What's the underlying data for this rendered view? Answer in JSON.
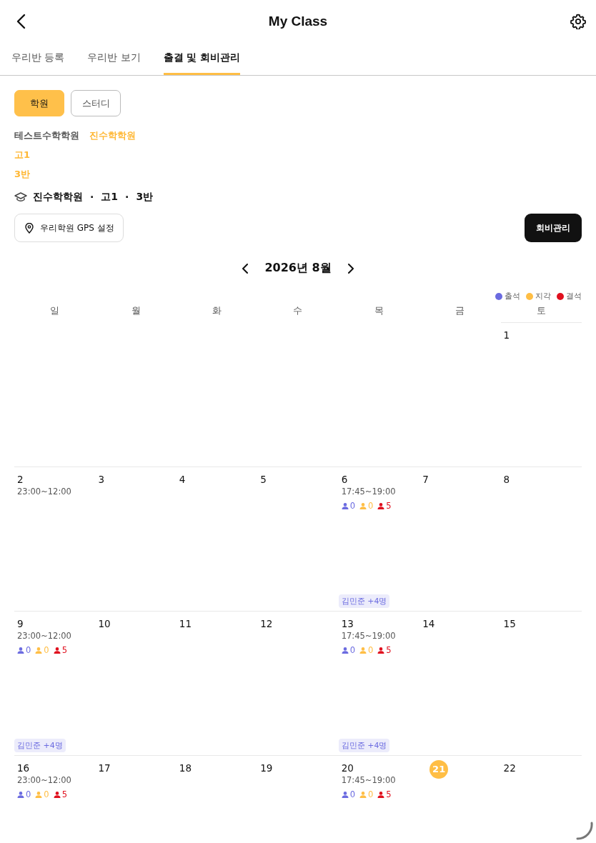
{
  "header": {
    "title": "My Class"
  },
  "tabs": [
    {
      "label": "우리반 등록",
      "selected": false
    },
    {
      "label": "우리반 보기",
      "selected": false
    },
    {
      "label": "출결 및 회비관리",
      "selected": true
    }
  ],
  "segments": [
    {
      "label": "학원",
      "selected": true
    },
    {
      "label": "스터디",
      "selected": false
    }
  ],
  "academies": [
    {
      "label": "테스트수학학원",
      "selected": false
    },
    {
      "label": "진수학학원",
      "selected": true
    }
  ],
  "grades": [
    {
      "label": "고1",
      "selected": true
    }
  ],
  "classes": [
    {
      "label": "3반",
      "selected": true
    }
  ],
  "summary": {
    "academy": "진수학학원",
    "separator_1": "·",
    "grade": "고1",
    "separator_2": "·",
    "class": "3반"
  },
  "gps_button": {
    "label": "우리학원 GPS 설정"
  },
  "fee_button": {
    "label": "회비관리"
  },
  "calendar": {
    "month": "2026년 8월",
    "legend": [
      {
        "label": "출석",
        "color": "#6b6be0"
      },
      {
        "label": "지각",
        "color": "#ffbe45"
      },
      {
        "label": "결석",
        "color": "#e0101e"
      }
    ],
    "weekdays": [
      "일",
      "월",
      "화",
      "수",
      "목",
      "금",
      "토"
    ],
    "weeks": [
      [
        {
          "day": "1",
          "selected": false
        }
      ],
      [
        {
          "day": "2",
          "selected": false,
          "time": "23:00~12:00"
        },
        {
          "day": "3",
          "selected": false
        },
        {
          "day": "4",
          "selected": false
        },
        {
          "day": "5",
          "selected": false
        },
        {
          "day": "6",
          "selected": false,
          "time": "17:45~19:00",
          "counts": [
            {
              "value": "0",
              "color": "#6b6be0"
            },
            {
              "value": "0",
              "color": "#ffbe45"
            },
            {
              "value": "5",
              "color": "#e0101e"
            }
          ],
          "students": "김민준 +4명"
        },
        {
          "day": "7",
          "selected": false
        },
        {
          "day": "8",
          "selected": false
        }
      ],
      [
        {
          "day": "9",
          "selected": false,
          "time": "23:00~12:00",
          "counts": [
            {
              "value": "0",
              "color": "#6b6be0"
            },
            {
              "value": "0",
              "color": "#ffbe45"
            },
            {
              "value": "5",
              "color": "#e0101e"
            }
          ],
          "students": "김민준 +4명"
        },
        {
          "day": "10",
          "selected": false
        },
        {
          "day": "11",
          "selected": false
        },
        {
          "day": "12",
          "selected": false
        },
        {
          "day": "13",
          "selected": false,
          "time": "17:45~19:00",
          "counts": [
            {
              "value": "0",
              "color": "#6b6be0"
            },
            {
              "value": "0",
              "color": "#ffbe45"
            },
            {
              "value": "5",
              "color": "#e0101e"
            }
          ],
          "students": "김민준 +4명"
        },
        {
          "day": "14",
          "selected": false
        },
        {
          "day": "15",
          "selected": false
        }
      ],
      [
        {
          "day": "16",
          "selected": false,
          "time": "23:00~12:00",
          "counts": [
            {
              "value": "0",
              "color": "#6b6be0"
            },
            {
              "value": "0",
              "color": "#ffbe45"
            },
            {
              "value": "5",
              "color": "#e0101e"
            }
          ]
        },
        {
          "day": "17",
          "selected": false
        },
        {
          "day": "18",
          "selected": false
        },
        {
          "day": "19",
          "selected": false
        },
        {
          "day": "20",
          "selected": false,
          "time": "17:45~19:00",
          "counts": [
            {
              "value": "0",
              "color": "#6b6be0"
            },
            {
              "value": "0",
              "color": "#ffbe45"
            },
            {
              "value": "5",
              "color": "#e0101e"
            }
          ]
        },
        {
          "day": "21",
          "selected": true
        },
        {
          "day": "22",
          "selected": false
        }
      ]
    ]
  }
}
